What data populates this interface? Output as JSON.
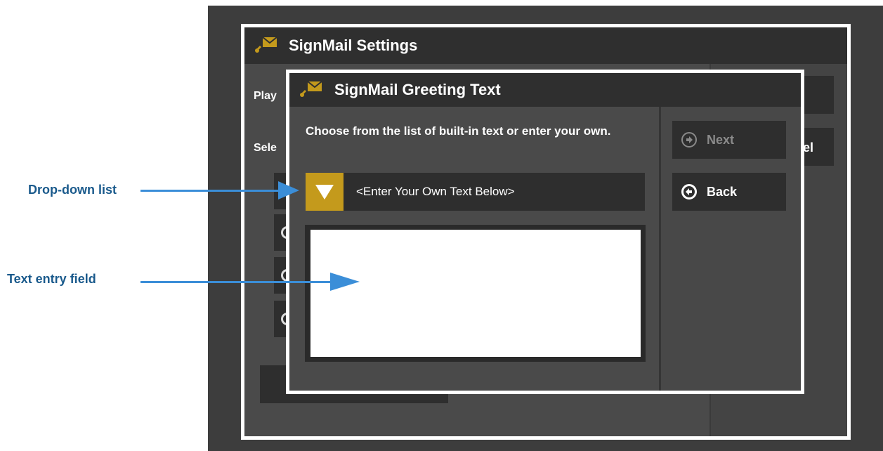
{
  "settings": {
    "title": "SignMail Settings",
    "truncated_labels": [
      "Play",
      "Sele"
    ],
    "right_truncated_label": "el"
  },
  "dialog": {
    "title": "SignMail Greeting Text",
    "instructions": "Choose from the list of built-in text or enter your own.",
    "dropdown": {
      "selected": "<Enter Your Own Text Below>"
    },
    "text_field": {
      "value": ""
    },
    "buttons": {
      "next": {
        "label": "Next",
        "enabled": false
      },
      "back": {
        "label": "Back",
        "enabled": true
      }
    }
  },
  "callouts": {
    "dropdown_label": "Drop-down list",
    "text_field_label": "Text entry field"
  },
  "colors": {
    "accent": "#c49a1c",
    "callout_text": "#1a5a8c",
    "callout_arrow": "#3b8ed8"
  }
}
